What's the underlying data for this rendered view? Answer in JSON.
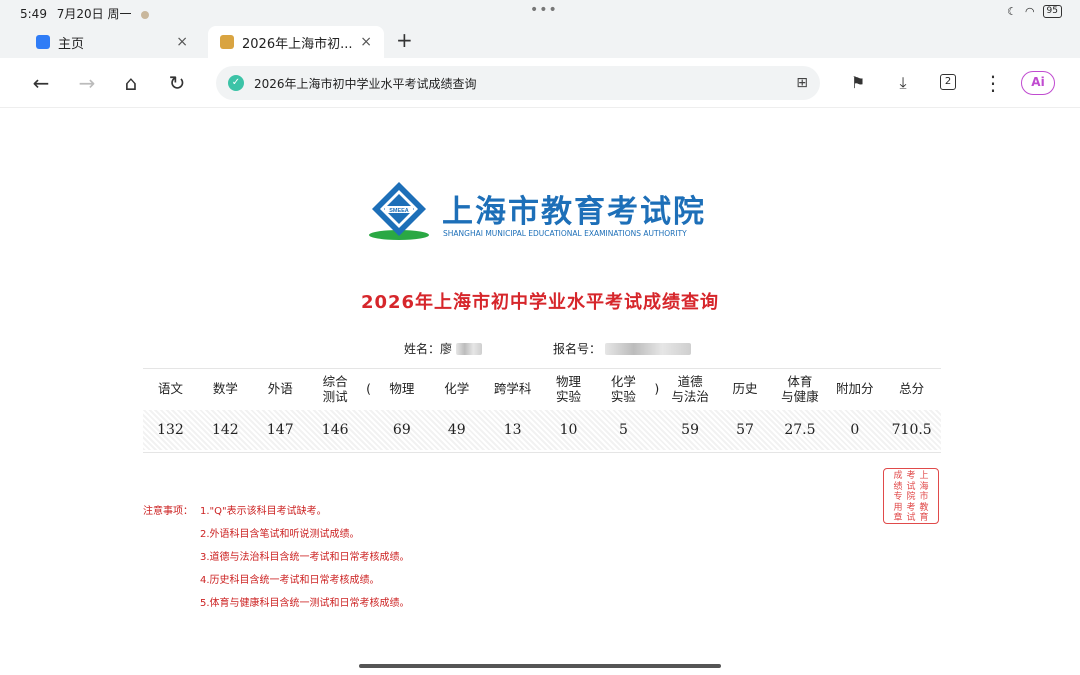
{
  "status_bar": {
    "time": "5:49",
    "date": "7月20日 周一",
    "more": "•••",
    "battery": "95"
  },
  "tabs": [
    {
      "label": "主页",
      "close": "×"
    },
    {
      "label": "2026年上海市初...",
      "close": "×"
    }
  ],
  "new_tab": "+",
  "toolbar": {
    "back": "←",
    "forward": "→",
    "home": "⌂",
    "refresh": "↻",
    "url": "2026年上海市初中学业水平考试成绩查询",
    "tab_count": "2",
    "menu": "⋮",
    "ai": "Ai"
  },
  "page": {
    "logo_cn": "上海市教育考试院",
    "logo_en": "SHANGHAI MUNICIPAL EDUCATIONAL EXAMINATIONS AUTHORITY",
    "logo_badge": "SMEEA",
    "title": "2026年上海市初中学业水平考试成绩查询",
    "name_label": "姓名：",
    "name_value": "廖",
    "reg_label": "报名号：",
    "headers": [
      "语文",
      "数学",
      "外语",
      "综合\n测试",
      "(",
      "物理",
      "化学",
      "跨学科",
      "物理\n实验",
      "化学\n实验",
      ")",
      "道德\n与法治",
      "历史",
      "体育\n与健康",
      "附加分",
      "总分"
    ],
    "scores": [
      "132",
      "142",
      "147",
      "146",
      "",
      "69",
      "49",
      "13",
      "10",
      "5",
      "",
      "59",
      "57",
      "27.5",
      "0",
      "710.5"
    ],
    "seal_columns": [
      [
        "上",
        "海",
        "市",
        "教",
        "育"
      ],
      [
        "考",
        "试",
        "院",
        "考",
        "试"
      ],
      [
        "成",
        "绩",
        "专",
        "用",
        "章"
      ]
    ],
    "notes_heading": "注意事项：",
    "notes": [
      "1.\"Q\"表示该科目考试缺考。",
      "2.外语科目含笔试和听说测试成绩。",
      "3.道德与法治科目含统一考试和日常考核成绩。",
      "4.历史科目含统一考试和日常考核成绩。",
      "5.体育与健康科目含统一测试和日常考核成绩。"
    ]
  }
}
